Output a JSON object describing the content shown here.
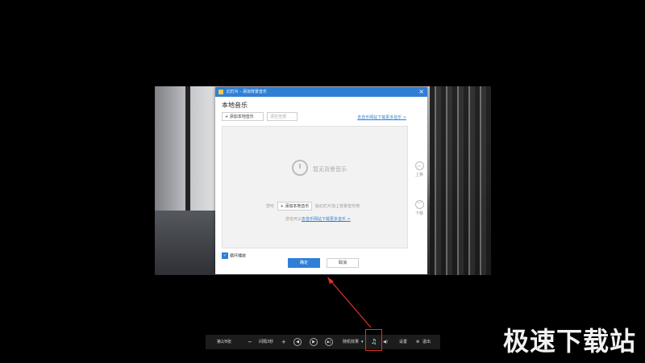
{
  "dialog": {
    "title": "幻灯片 - 添加背景音乐",
    "close_glyph": "×",
    "section_title": "本地音乐",
    "add_button": "+ 添加本地音乐",
    "clear_button": "清空全部",
    "more_link": "去音乐网站下载更多音乐 >",
    "empty_text": "暂无背景音乐",
    "hint_prefix": "您可",
    "hint_button": "+ 添加本地音乐",
    "hint_suffix": "给幻灯片加上背景音乐吧",
    "hint2_prefix": "您也可以",
    "hint2_link": "去音乐网站下载更多音乐 >",
    "up_label": "上移",
    "down_label": "下移",
    "loop_label": "循环播放",
    "ok_button": "确定",
    "cancel_button": "取消"
  },
  "controls": {
    "page": "第2/8张",
    "minus": "−",
    "interval": "间隔3秒",
    "plus": "+",
    "prev": "◀",
    "play": "▶",
    "next": "▶|",
    "effect": "随机效果",
    "music_icon_glyph": "♫",
    "volume_icon_glyph": "◀)",
    "settings": "设置",
    "exit": "退出"
  },
  "watermark": "极速下载站",
  "colors": {
    "accent": "#2f7fd6",
    "highlight": "#e0322b"
  }
}
